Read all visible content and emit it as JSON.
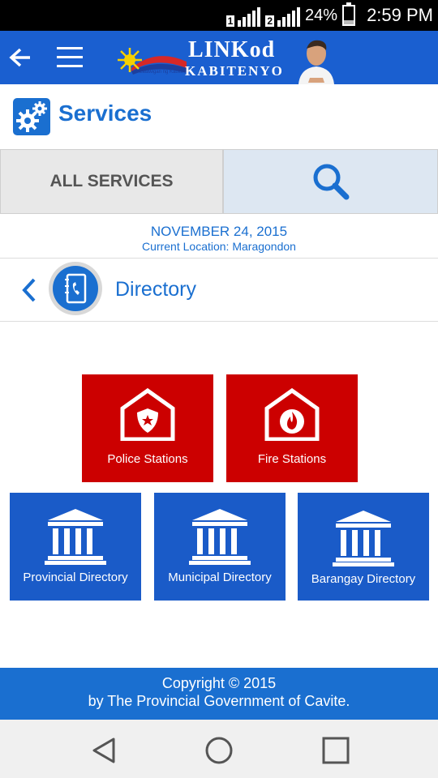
{
  "status_bar": {
    "sim1": "1",
    "sim2": "2",
    "battery": "24%",
    "time": "2:59 PM"
  },
  "app_bar": {
    "brand_line1": "LINKod",
    "brand_line2": "KABITENYO",
    "brand_small": "Lalawigan ng Kabite"
  },
  "services": {
    "title": "Services"
  },
  "tabs": {
    "all_services": "ALL SERVICES"
  },
  "info": {
    "date": "NOVEMBER 24, 2015",
    "location": "Current Location: Maragondon"
  },
  "directory": {
    "title": "Directory"
  },
  "tiles": [
    {
      "label": "Police Stations",
      "icon": "police-station-icon",
      "color": "#cc0000"
    },
    {
      "label": "Fire Stations",
      "icon": "fire-station-icon",
      "color": "#cc0000"
    },
    {
      "label": "Provincial Directory",
      "icon": "government-building-icon",
      "color": "#1a5bc8"
    },
    {
      "label": "Municipal Directory",
      "icon": "government-building-icon",
      "color": "#1a5bc8"
    },
    {
      "label": "Barangay Directory",
      "icon": "government-building-icon",
      "color": "#1a5bc8"
    }
  ],
  "footer": {
    "line1": "Copyright © 2015",
    "line2": "by The Provincial Government of Cavite."
  },
  "colors": {
    "accent": "#1a6fd0",
    "app_bar": "#1a5fd0",
    "red_tile": "#cc0000",
    "blue_tile": "#1a5bc8"
  }
}
